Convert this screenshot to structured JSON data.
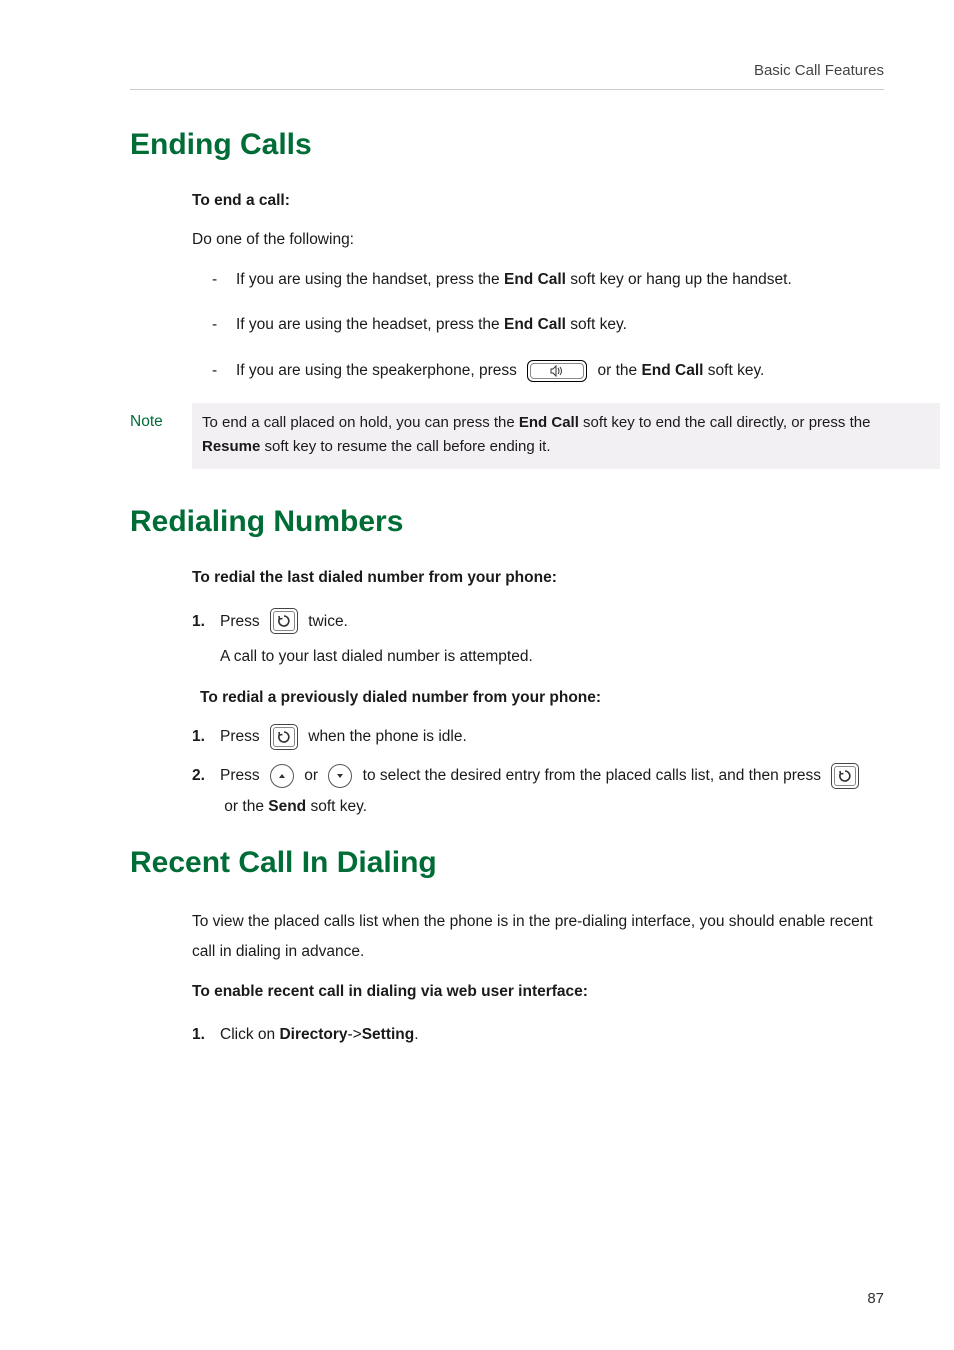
{
  "header": {
    "breadcrumb": "Basic Call Features"
  },
  "section1": {
    "title": "Ending Calls",
    "subhead": "To end a call:",
    "lead": "Do one of the following:",
    "bullets": {
      "b1a": "If you are using the handset, press the ",
      "b1b": "End Call",
      "b1c": " soft key or hang up the handset.",
      "b2a": "If you are using the headset, press the ",
      "b2b": "End Call",
      "b2c": " soft key.",
      "b3a": "If you are using the speakerphone, press ",
      "b3b": " or the ",
      "b3c": "End Call",
      "b3d": " soft key."
    },
    "note": {
      "label": "Note",
      "t1": "To end a call placed on hold, you can press the ",
      "t2": "End Call",
      "t3": " soft key to end the call directly, or press the ",
      "t4": "Resume",
      "t5": " soft key to resume the call before ending it."
    }
  },
  "section2": {
    "title": "Redialing Numbers",
    "subhead1": "To redial the last dialed number from your phone:",
    "step1_pre": "Press ",
    "step1_post": " twice.",
    "step1_follow": "A call to your last dialed number is attempted.",
    "subhead2": "To redial a previously dialed number from your phone:",
    "s2_1_pre": "Press ",
    "s2_1_post": " when the phone is idle.",
    "s2_2_pre": "Press ",
    "s2_2_or": " or ",
    "s2_2_mid": " to select the desired entry from the placed calls list, and then press ",
    "s2_2_orthe": " or the ",
    "s2_2_send": "Send",
    "s2_2_post": " soft key."
  },
  "section3": {
    "title": "Recent Call In Dialing",
    "lead": "To view the placed calls list when the phone is in the pre-dialing interface, you should enable recent call in dialing in advance.",
    "subhead": "To enable recent call in dialing via web user interface:",
    "step1_a": "Click on ",
    "step1_b": "Directory",
    "step1_c": "->",
    "step1_d": "Setting",
    "step1_e": "."
  },
  "page": {
    "num": "87"
  },
  "markers": {
    "one": "1.",
    "two": "2."
  }
}
